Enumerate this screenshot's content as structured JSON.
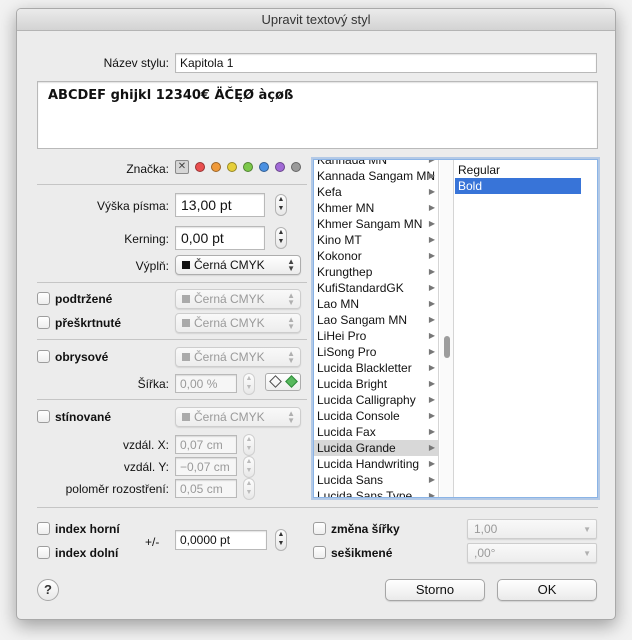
{
  "window": {
    "title": "Upravit textový styl"
  },
  "style_name": {
    "label": "Název stylu:",
    "value": "Kapitola 1"
  },
  "preview": {
    "text": "ABCDEF ghijkl 12340€ ÄČĘØ àçøß"
  },
  "mark": {
    "label": "Značka:",
    "clear": "✕",
    "colors": [
      "#e94e4e",
      "#f09a3a",
      "#e6cf3a",
      "#7cc84a",
      "#4a90e2",
      "#a16ad6",
      "#9a9a9a"
    ]
  },
  "font_size": {
    "label": "Výška písma:",
    "value": "13,00 pt"
  },
  "kerning": {
    "label": "Kerning:",
    "value": "0,00 pt"
  },
  "fill": {
    "label": "Výplň:",
    "value": "Černá CMYK"
  },
  "underline": {
    "label": "podtržené",
    "value": "Černá CMYK"
  },
  "strike": {
    "label": "přeškrtnuté",
    "value": "Černá CMYK"
  },
  "outline": {
    "label": "obrysové",
    "value": "Černá CMYK",
    "width_label": "Šířka:",
    "width_value": "0,00 %"
  },
  "shadow": {
    "label": "stínované",
    "value": "Černá CMYK",
    "dx_label": "vzdál. X:",
    "dx_value": "0,07 cm",
    "dy_label": "vzdál. Y:",
    "dy_value": "−0,07 cm",
    "blur_label": "poloměr rozostření:",
    "blur_value": "0,05 cm"
  },
  "fonts": [
    "Kannada MN",
    "Kannada Sangam MN",
    "Kefa",
    "Khmer MN",
    "Khmer Sangam MN",
    "Kino MT",
    "Kokonor",
    "Krungthep",
    "KufiStandardGK",
    "Lao MN",
    "Lao Sangam MN",
    "LiHei Pro",
    "LiSong Pro",
    "Lucida Blackletter",
    "Lucida Bright",
    "Lucida Calligraphy",
    "Lucida Console",
    "Lucida Fax",
    "Lucida Grande",
    "Lucida Handwriting",
    "Lucida Sans",
    "Lucida Sans Type..."
  ],
  "font_selected_index": 18,
  "styles": [
    "Regular",
    "Bold"
  ],
  "style_selected_index": 1,
  "superscript": {
    "label": "index horní"
  },
  "subscript": {
    "label": "index dolní"
  },
  "baseline": {
    "label": "+/-",
    "value": "0,0000 pt"
  },
  "width_change": {
    "label": "změna šířky",
    "value": "1,00"
  },
  "skew": {
    "label": "sešikmené",
    "value": ",00°"
  },
  "buttons": {
    "help": "?",
    "cancel": "Storno",
    "ok": "OK"
  }
}
